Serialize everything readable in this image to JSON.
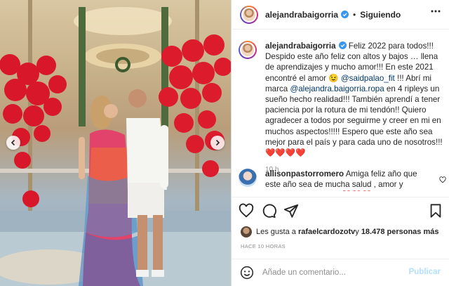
{
  "post": {
    "username": "alejandrabaigorria",
    "follow_label": "Siguiendo",
    "separator": "•",
    "caption": {
      "username": "alejandrabaigorria",
      "line1": " Feliz 2022 para todos!!!",
      "line2": "Despido este año feliz con altos y bajos … llena de aprendizajes y mucho amor!!! En este 2021 encontré el amor 😉 ",
      "mention1": "@saidpalao_fit",
      "line3": " !!! Abrí mi marca ",
      "mention2": "@alejandra.baigorria.ropa",
      "line4": " en 4 ripleys un sueño hecho realidad!!! También aprendí a tener paciencia por la rotura de mi tendón!! Quiero agradecer a todos por seguirme y creer en mi en muchos aspectos!!!!! Espero que este año sea mejor para el país y para cada uno de nosotros!!! ❤️❤️❤️❤️"
    },
    "time_ago": "10 h",
    "comment": {
      "username": "allisonpastorromero",
      "text": " Amiga feliz año que este año sea de mucha salud , amor y muchas bendiciones ❤️❤️❤️"
    },
    "likes": {
      "prefix": "Les gusta a ",
      "user": "rafaelcardozotv",
      "middle": " y ",
      "count": "18.478 personas más"
    },
    "posted_ago": "HACE 10 HORAS",
    "add_comment": {
      "placeholder": "Añade un comentario...",
      "post_label": "Publicar"
    }
  },
  "icons": {
    "header": [
      "verified-badge-icon",
      "more-options-icon"
    ],
    "actions": [
      "heart-icon",
      "comment-icon",
      "share-icon",
      "bookmark-icon"
    ],
    "photo_nav": [
      "chevron-left-icon",
      "chevron-right-icon"
    ],
    "composer": [
      "emoji-icon"
    ]
  },
  "colors": {
    "link": "#00376b",
    "verified": "#3897f0",
    "publish_disabled": "#b2dffc",
    "muted": "#8e8e8e"
  }
}
